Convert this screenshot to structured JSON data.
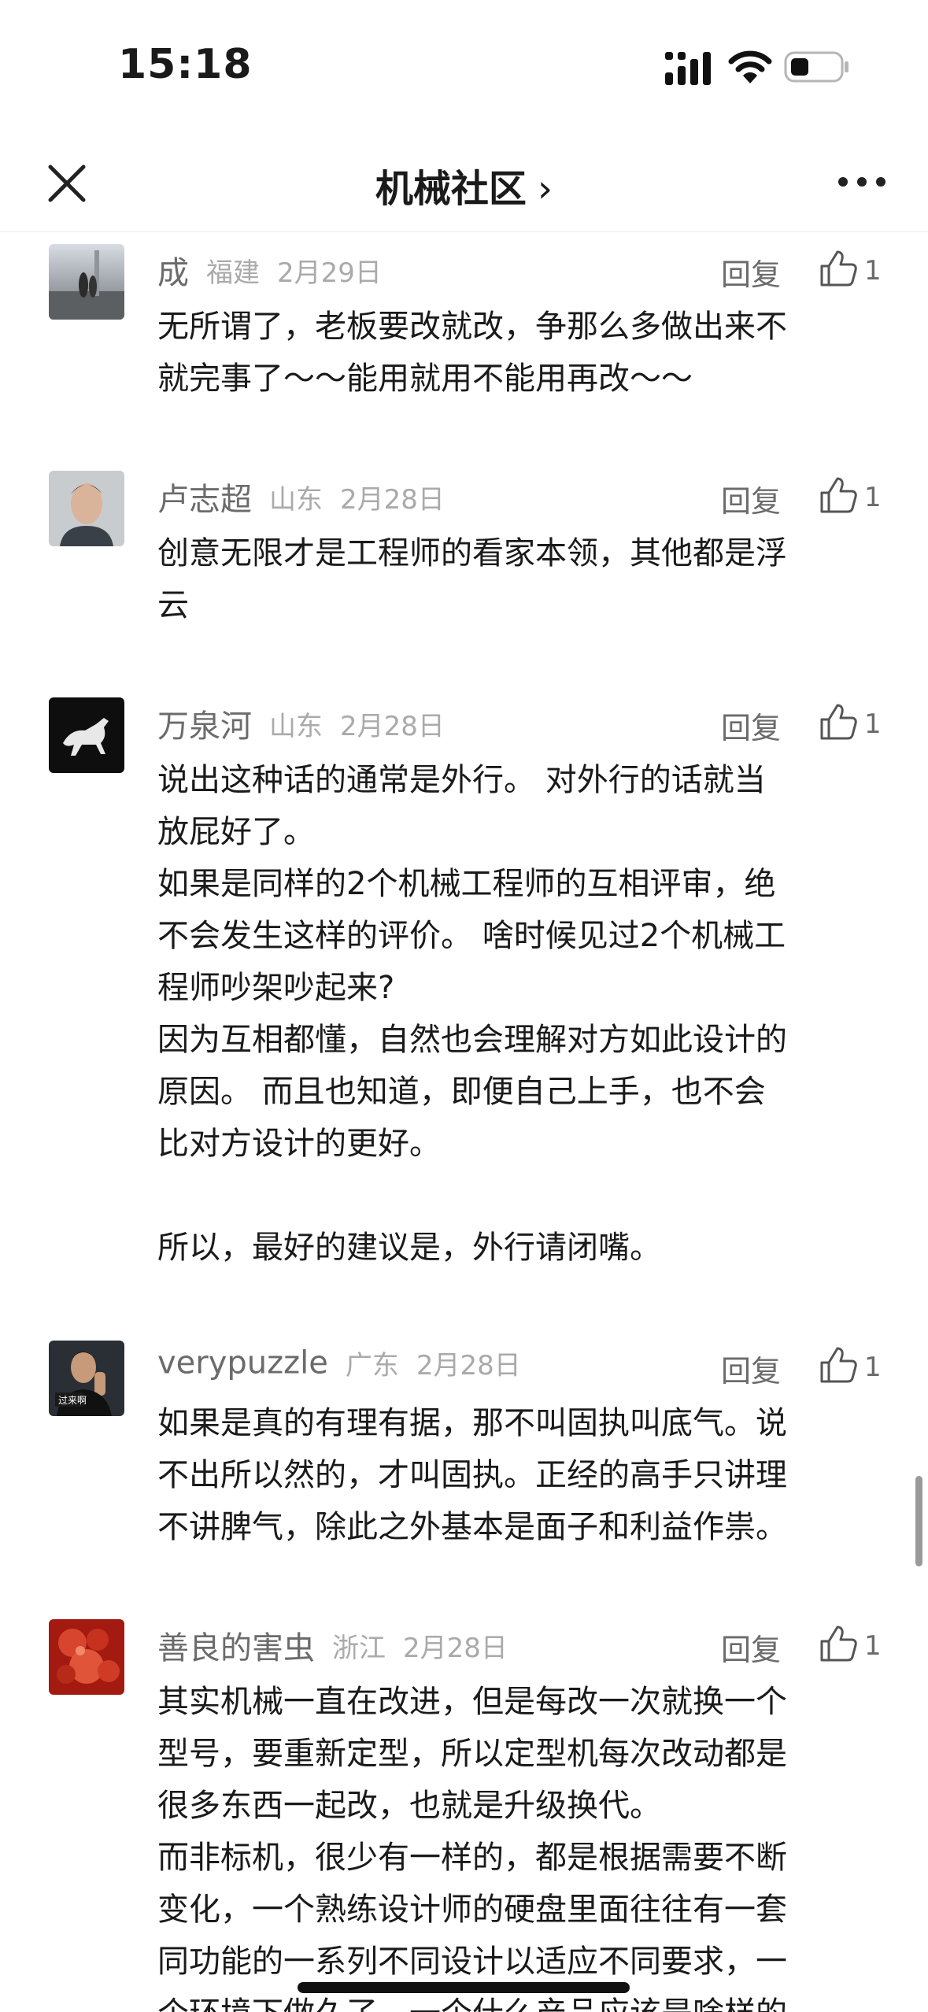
{
  "status": {
    "time": "15:18"
  },
  "nav": {
    "title": "机械社区",
    "chevron": "›"
  },
  "comments": [
    {
      "name": "成",
      "location": "福建",
      "date": "2月29日",
      "reply": "回复",
      "likes": "1",
      "lines": [
        "无所谓了，老板要改就改，争那么多做出来不",
        "就完事了～～能用就用不能用再改～～"
      ]
    },
    {
      "name": "卢志超",
      "location": "山东",
      "date": "2月28日",
      "reply": "回复",
      "likes": "1",
      "lines": [
        "创意无限才是工程师的看家本领，其他都是浮",
        "云"
      ]
    },
    {
      "name": "万泉河",
      "location": "山东",
      "date": "2月28日",
      "reply": "回复",
      "likes": "1",
      "lines": [
        "说出这种话的通常是外行。 对外行的话就当",
        "放屁好了。",
        "如果是同样的2个机械工程师的互相评审，绝",
        "不会发生这样的评价。 啥时候见过2个机械工",
        "程师吵架吵起来?",
        "因为互相都懂，自然也会理解对方如此设计的",
        "原因。 而且也知道，即便自己上手，也不会",
        "比对方设计的更好。",
        "",
        "所以，最好的建议是，外行请闭嘴。"
      ]
    },
    {
      "name": "verypuzzle",
      "location": "广东",
      "date": "2月28日",
      "reply": "回复",
      "likes": "1",
      "lines": [
        "如果是真的有理有据，那不叫固执叫底气。说",
        "不出所以然的，才叫固执。正经的高手只讲理",
        "不讲脾气，除此之外基本是面子和利益作祟。"
      ]
    },
    {
      "name": "善良的害虫",
      "location": "浙江",
      "date": "2月28日",
      "reply": "回复",
      "likes": "1",
      "lines": [
        "其实机械一直在改进，但是每改一次就换一个",
        "型号，要重新定型，所以定型机每次改动都是",
        "很多东西一起改，也就是升级换代。",
        "而非标机，很少有一样的，都是根据需要不断",
        "变化，一个熟练设计师的硬盘里面往往有一套",
        "同功能的一系列不同设计以适应不同要求，一",
        "个环境下做久了，一个什么产品应该是啥样的"
      ]
    }
  ]
}
